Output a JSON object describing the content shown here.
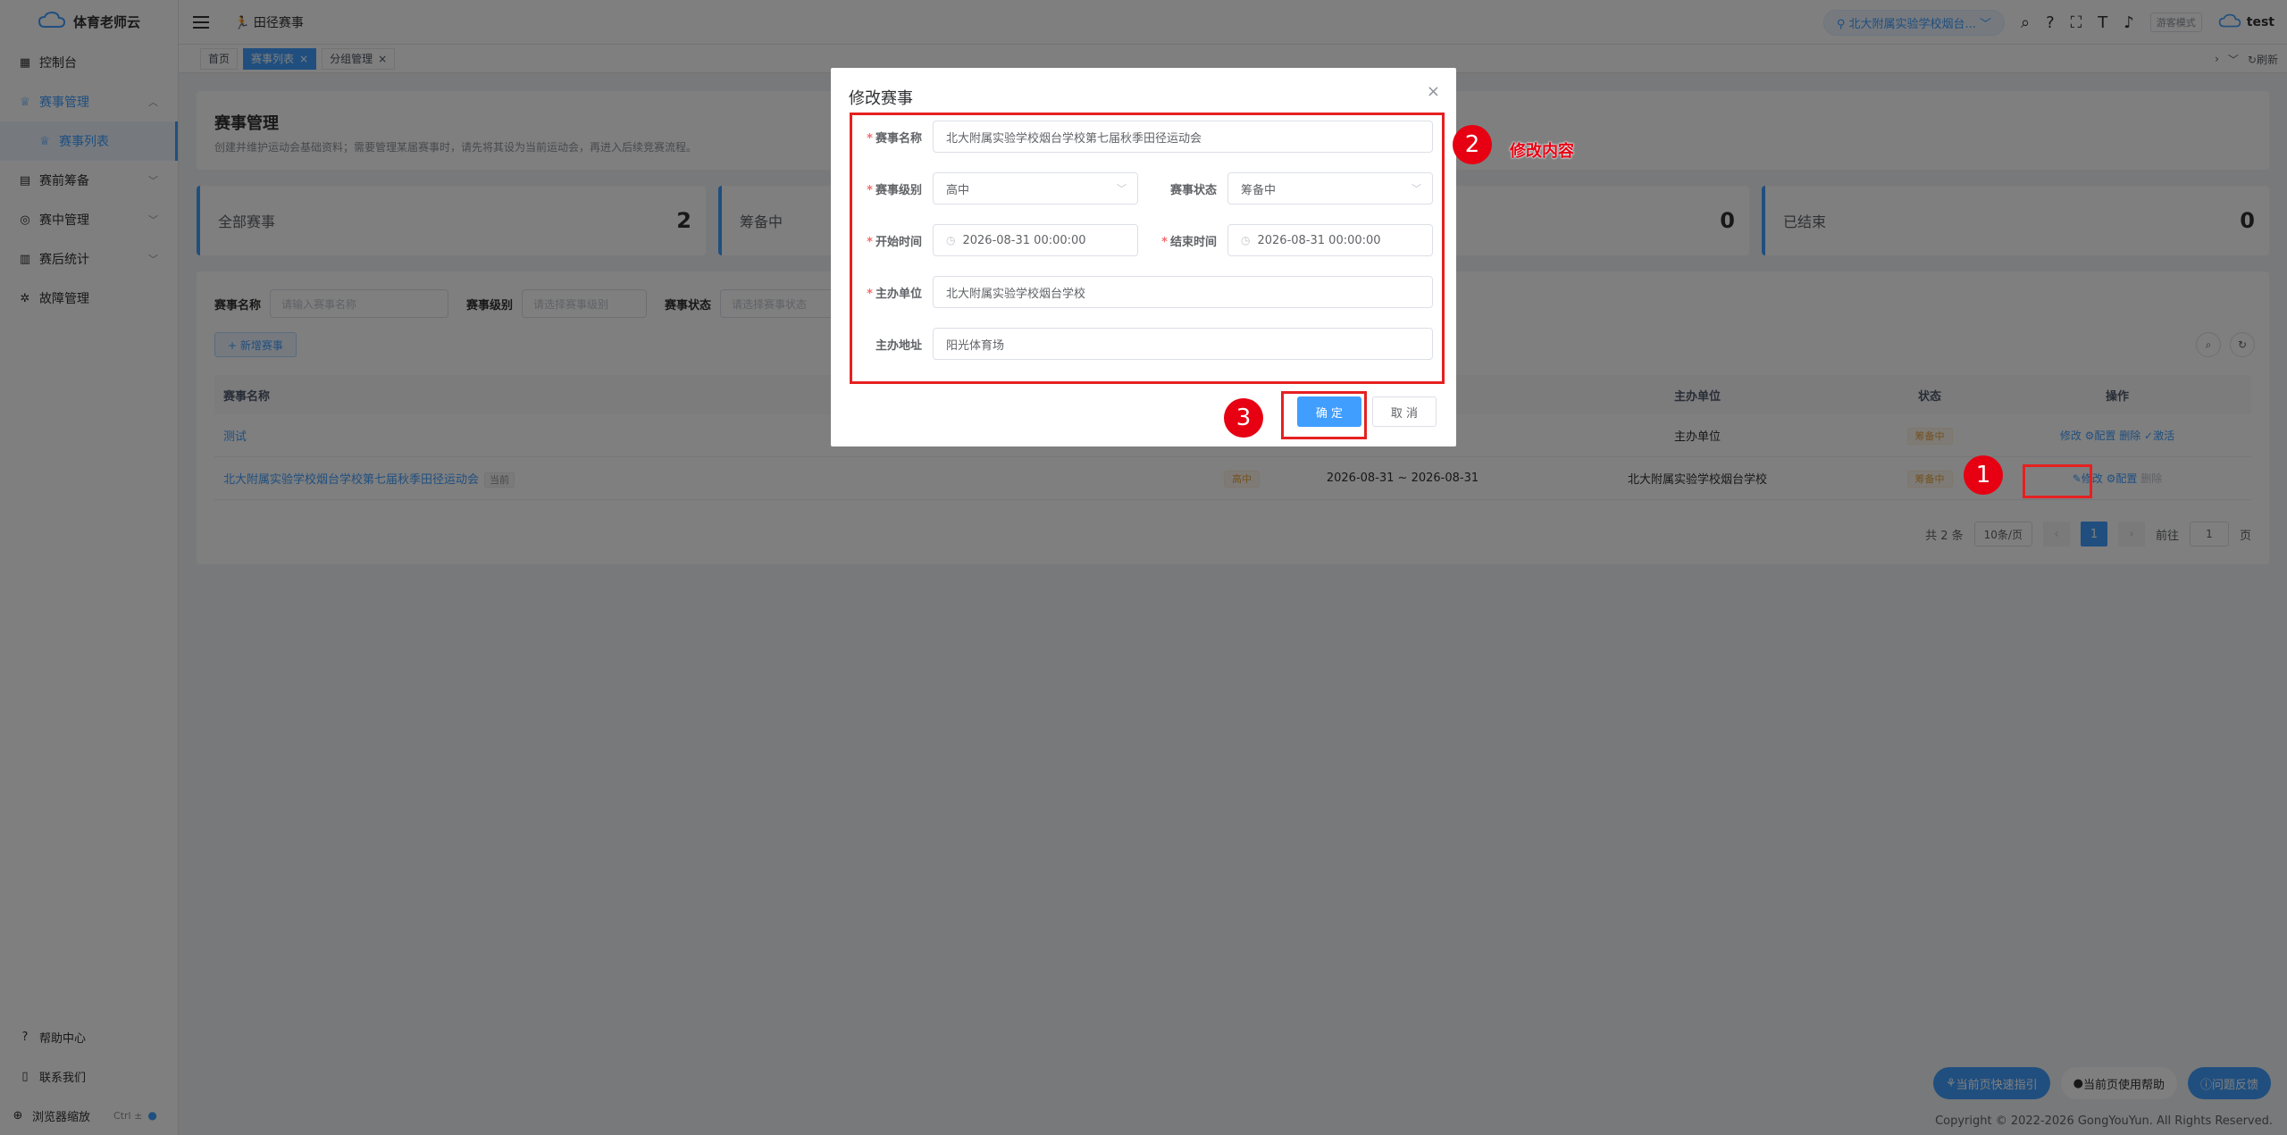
{
  "app": {
    "name": "体育老师云",
    "module": "田径赛事",
    "user": "test"
  },
  "sidebar": {
    "items": [
      {
        "label": "控制台",
        "icon": "dashboard-icon"
      },
      {
        "label": "赛事管理",
        "icon": "trophy-icon"
      },
      {
        "label": "赛事列表",
        "icon": "trophy-icon"
      },
      {
        "label": "赛前筹备",
        "icon": "clipboard-icon"
      },
      {
        "label": "赛中管理",
        "icon": "target-icon"
      },
      {
        "label": "赛后统计",
        "icon": "bar-chart-icon"
      },
      {
        "label": "故障管理",
        "icon": "bug-icon"
      }
    ],
    "bottom": [
      {
        "label": "帮助中心"
      },
      {
        "label": "联系我们"
      },
      {
        "label": "浏览器缩放",
        "shortcut": "Ctrl ±"
      }
    ]
  },
  "header": {
    "school": "北大附属实验学校烟台...",
    "guest_mode": "游客模式"
  },
  "tags": [
    "首页",
    "赛事列表",
    "分组管理"
  ],
  "tags_refresh": "刷新",
  "page": {
    "title": "赛事管理",
    "desc": "创建并维护运动会基础资料；需要管理某届赛事时，请先将其设为当前运动会，再进入后续竞赛流程。"
  },
  "stats": [
    {
      "label": "全部赛事",
      "value": "2"
    },
    {
      "label": "筹备中",
      "value": ""
    },
    {
      "label": "",
      "value": "0"
    },
    {
      "label": "已结束",
      "value": "0"
    }
  ],
  "filters": {
    "name_label": "赛事名称",
    "name_placeholder": "请输入赛事名称",
    "level_label": "赛事级别",
    "level_placeholder": "请选择赛事级别",
    "status_label": "赛事状态",
    "status_placeholder": "请选择赛事状态"
  },
  "add_button": "+ 新增赛事",
  "table": {
    "headers": [
      "赛事名称",
      "主办单位",
      "状态",
      "操作"
    ],
    "rows": [
      {
        "name": "测试",
        "level": "",
        "date": "",
        "org": "主办单位",
        "status": "筹备中",
        "ops": "修改 ⚙配置 删除 ✓激活"
      },
      {
        "name": "北大附属实验学校烟台学校第七届秋季田径运动会",
        "tag": "当前",
        "level": "高中",
        "date": "2026-08-31 ~ 2026-08-31",
        "org": "北大附属实验学校烟台学校",
        "status": "筹备中",
        "ops": "修改",
        "ops2": "⚙配置",
        "ops3": "删除"
      }
    ]
  },
  "pager": {
    "total": "共 2 条",
    "size": "10条/页",
    "page": "1",
    "goto": "前往",
    "goto_val": "1",
    "unit": "页"
  },
  "float_buttons": [
    "当前页快速指引",
    "当前页使用帮助",
    "问题反馈"
  ],
  "footer": "Copyright © 2022-2026 GongYouYun. All Rights Reserved.",
  "dialog": {
    "title": "修改赛事",
    "fields": {
      "name_label": "赛事名称",
      "name_value": "北大附属实验学校烟台学校第七届秋季田径运动会",
      "level_label": "赛事级别",
      "level_value": "高中",
      "status_label": "赛事状态",
      "status_value": "筹备中",
      "start_label": "开始时间",
      "start_value": "2026-08-31 00:00:00",
      "end_label": "结束时间",
      "end_value": "2026-08-31 00:00:00",
      "org_label": "主办单位",
      "org_value": "北大附属实验学校烟台学校",
      "addr_label": "主办地址",
      "addr_value": "阳光体育场"
    },
    "ok": "确 定",
    "cancel": "取 消"
  },
  "annotations": {
    "n1": "1",
    "n2": "2",
    "n3": "3",
    "text2": "修改内容"
  },
  "colors": {
    "primary": "#409eff",
    "annotation_red": "#e60012"
  }
}
